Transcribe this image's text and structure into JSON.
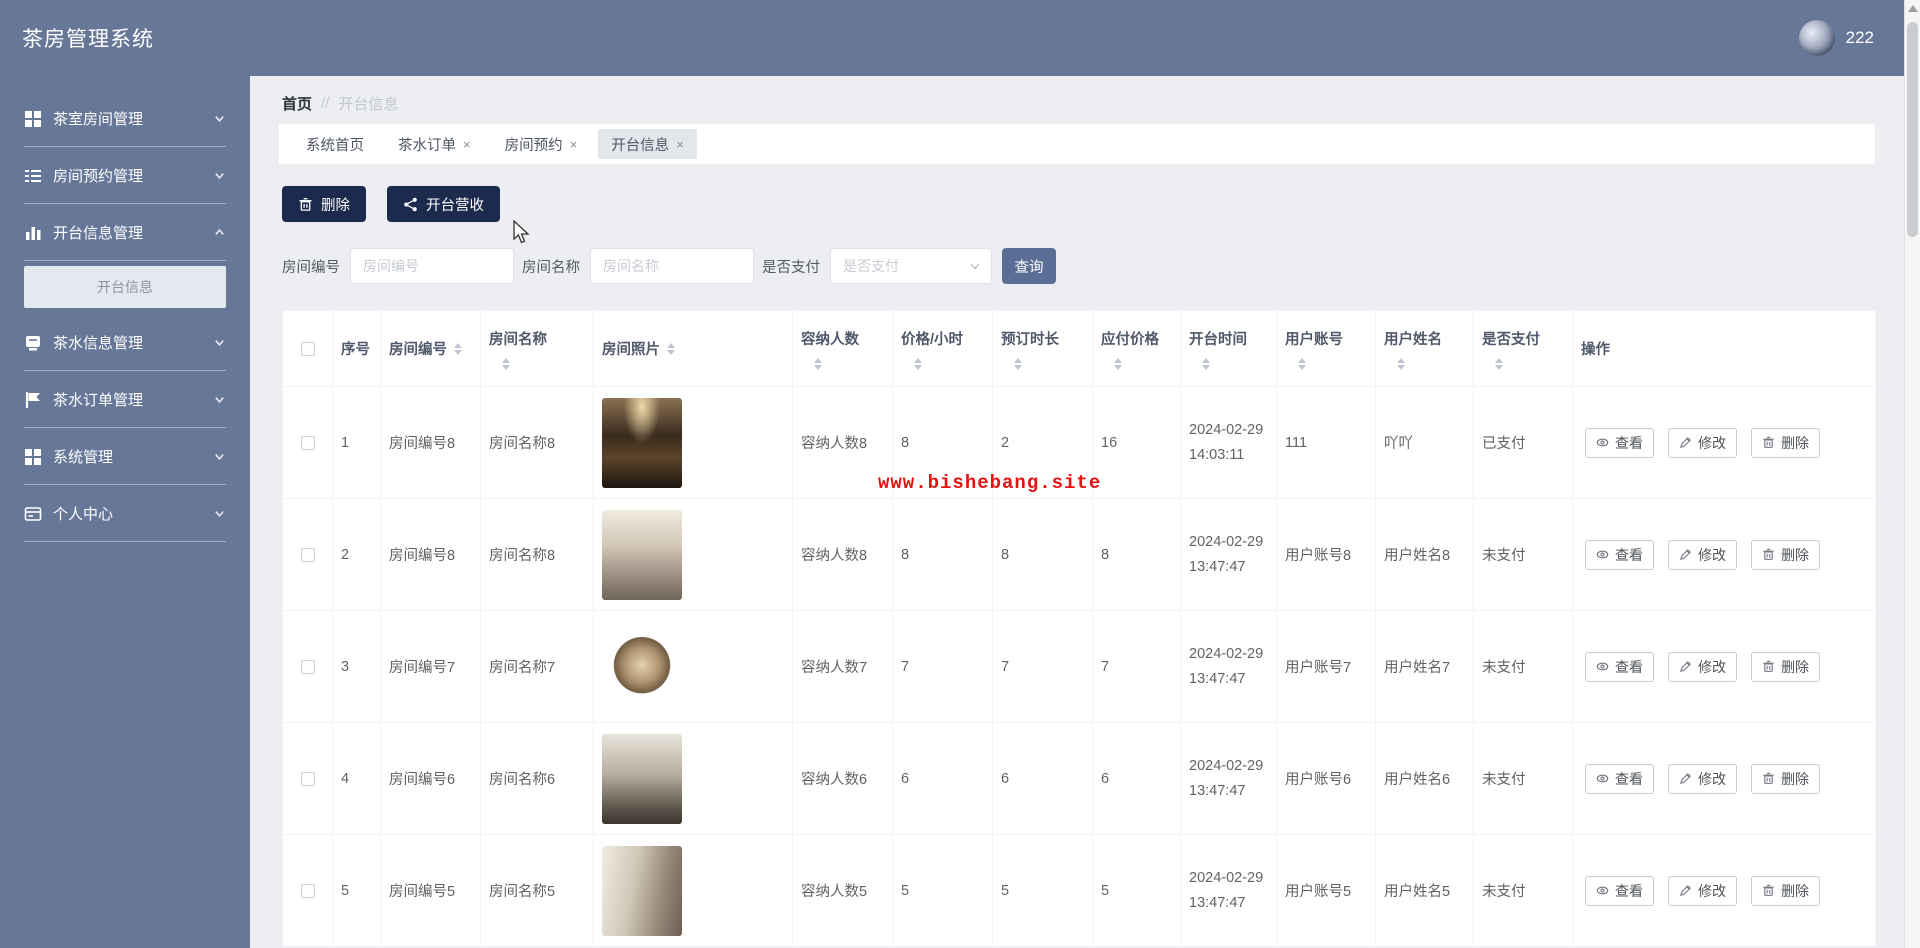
{
  "app": {
    "title": "茶房管理系统",
    "username": "222"
  },
  "sidebar": {
    "items": [
      {
        "label": "茶室房间管理",
        "icon": "grid-icon"
      },
      {
        "label": "房间预约管理",
        "icon": "list-icon"
      },
      {
        "label": "开台信息管理",
        "icon": "bar-chart-icon"
      },
      {
        "label": "茶水信息管理",
        "icon": "book-icon"
      },
      {
        "label": "茶水订单管理",
        "icon": "flag-icon"
      },
      {
        "label": "系统管理",
        "icon": "grid-icon"
      },
      {
        "label": "个人中心",
        "icon": "id-card-icon"
      }
    ],
    "active_submenu": "开台信息"
  },
  "breadcrumb": {
    "home": "首页",
    "separator": "//",
    "current": "开台信息"
  },
  "tabs_meta": {
    "close_glyph": "×"
  },
  "tabs": [
    {
      "label": "系统首页",
      "closable": false,
      "active": false
    },
    {
      "label": "茶水订单",
      "closable": true,
      "active": false
    },
    {
      "label": "房间预约",
      "closable": true,
      "active": false
    },
    {
      "label": "开台信息",
      "closable": true,
      "active": true
    }
  ],
  "toolbar": {
    "delete_label": "删除",
    "revenue_label": "开台营收"
  },
  "filters": {
    "room_no_label": "房间编号",
    "room_no_placeholder": "房间编号",
    "room_name_label": "房间名称",
    "room_name_placeholder": "房间名称",
    "paid_label": "是否支付",
    "paid_placeholder": "是否支付",
    "search_label": "查询"
  },
  "table": {
    "columns": [
      "序号",
      "房间编号",
      "房间名称",
      "房间照片",
      "容纳人数",
      "价格/小时",
      "预订时长",
      "应付价格",
      "开台时间",
      "用户账号",
      "用户姓名",
      "是否支付",
      "操作"
    ],
    "actions": {
      "view": "查看",
      "edit": "修改",
      "delete": "删除"
    },
    "rows": [
      {
        "index": "1",
        "room_no": "房间编号8",
        "room_name": "房间名称8",
        "photo": "tea-room-dark-interior",
        "capacity": "容纳人数8",
        "price": "8",
        "duration": "2",
        "payable": "16",
        "time": "2024-02-29 14:03:11",
        "account": "111",
        "name": "吖吖",
        "paid": "已支付"
      },
      {
        "index": "2",
        "room_no": "房间编号8",
        "room_name": "房间名称8",
        "photo": "tea-room-hallway",
        "capacity": "容纳人数8",
        "price": "8",
        "duration": "8",
        "payable": "8",
        "time": "2024-02-29 13:47:47",
        "account": "用户账号8",
        "name": "用户姓名8",
        "paid": "未支付"
      },
      {
        "index": "3",
        "room_no": "房间编号7",
        "room_name": "房间名称7",
        "photo": "tea-room-circular-view",
        "capacity": "容纳人数7",
        "price": "7",
        "duration": "7",
        "payable": "7",
        "time": "2024-02-29 13:47:47",
        "account": "用户账号7",
        "name": "用户姓名7",
        "paid": "未支付"
      },
      {
        "index": "4",
        "room_no": "房间编号6",
        "room_name": "房间名称6",
        "photo": "tea-room-seating",
        "capacity": "容纳人数6",
        "price": "6",
        "duration": "6",
        "payable": "6",
        "time": "2024-02-29 13:47:47",
        "account": "用户账号6",
        "name": "用户姓名6",
        "paid": "未支付"
      },
      {
        "index": "5",
        "room_no": "房间编号5",
        "room_name": "房间名称5",
        "photo": "tea-room-side-view",
        "capacity": "容纳人数5",
        "price": "5",
        "duration": "5",
        "payable": "5",
        "time": "2024-02-29 13:47:47",
        "account": "用户账号5",
        "name": "用户姓名5",
        "paid": "未支付"
      }
    ]
  },
  "watermark": "www.bishebang.site",
  "colors": {
    "sidebar": "#677798",
    "dark_button": "#1c2b4d",
    "search_button": "#5b6e96",
    "watermark_red": "#e81111",
    "active_tab": "#e3e6eb"
  }
}
